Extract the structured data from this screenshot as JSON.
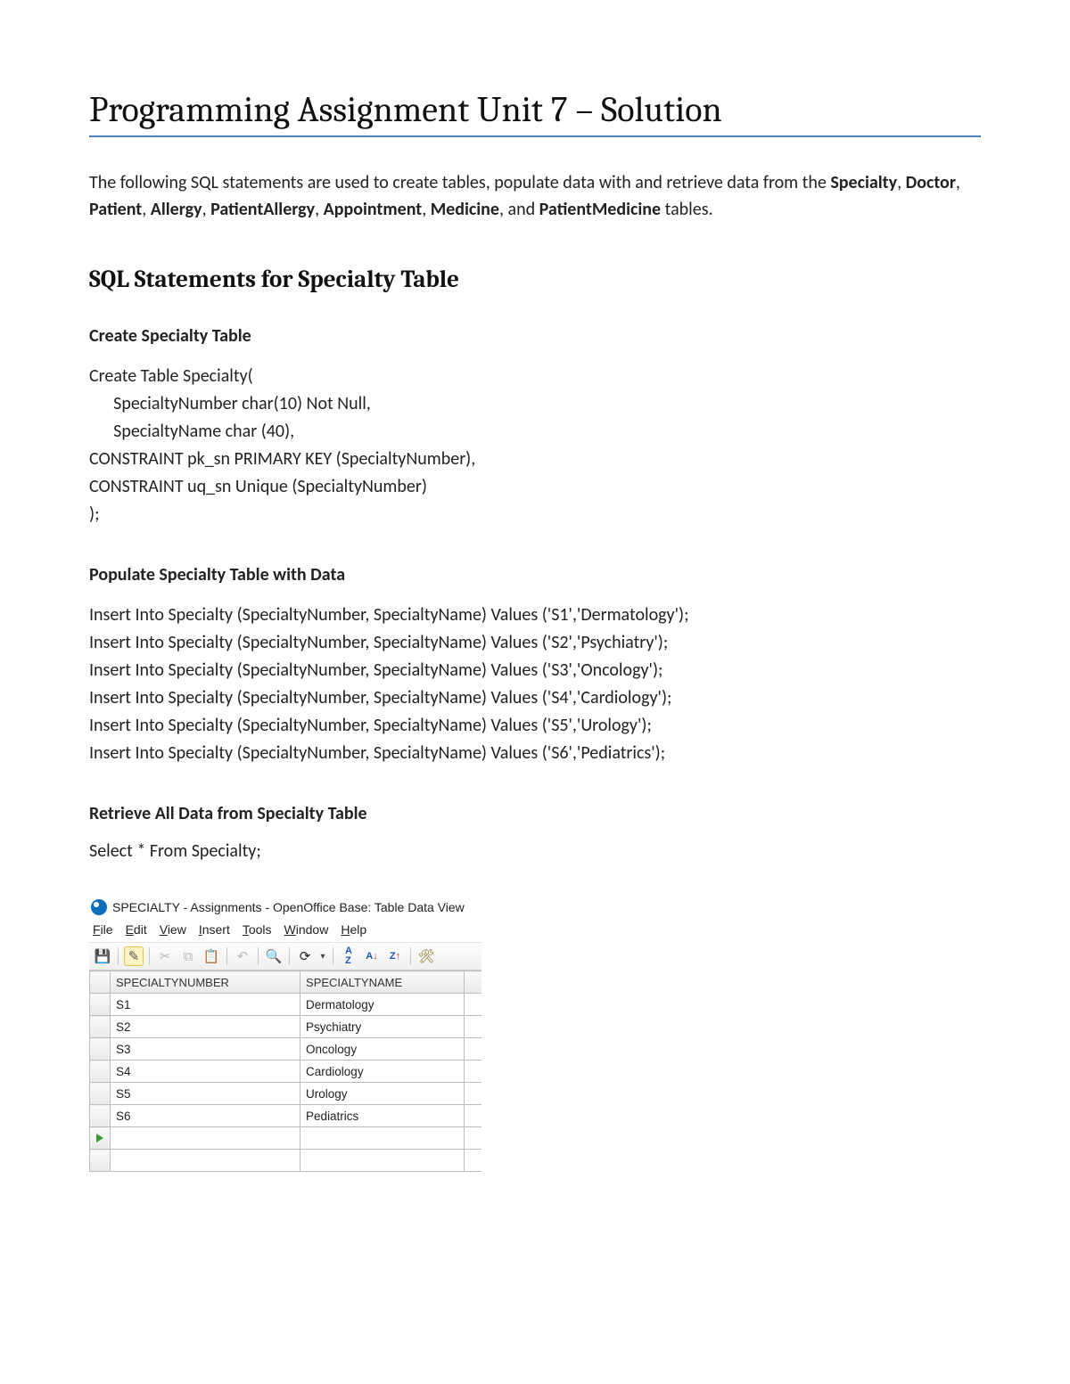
{
  "doc": {
    "title": "Programming Assignment Unit 7 – Solution",
    "intro_pre": "The following SQL statements are used to create tables, populate data with and retrieve data from the ",
    "intro_bold_tables": [
      "Specialty",
      "Doctor",
      "Patient",
      "Allergy",
      "PatientAllergy",
      "Appointment",
      "Medicine",
      "PatientMedicine"
    ],
    "intro_join_last": ", and ",
    "intro_post": " tables.",
    "section_heading": "SQL Statements for Specialty Table",
    "sub_create": "Create Specialty Table",
    "create_sql": "Create Table Specialty(\n      SpecialtyNumber char(10) Not Null,\n      SpecialtyName char (40),\nCONSTRAINT pk_sn PRIMARY KEY (SpecialtyNumber),\nCONSTRAINT uq_sn Unique (SpecialtyNumber)\n);",
    "sub_populate": "Populate Specialty Table with Data",
    "insert_sql": "Insert Into Specialty (SpecialtyNumber, SpecialtyName) Values ('S1','Dermatology');\nInsert Into Specialty (SpecialtyNumber, SpecialtyName) Values ('S2','Psychiatry');\nInsert Into Specialty (SpecialtyNumber, SpecialtyName) Values ('S3','Oncology');\nInsert Into Specialty (SpecialtyNumber, SpecialtyName) Values ('S4','Cardiology');\nInsert Into Specialty (SpecialtyNumber, SpecialtyName) Values ('S5','Urology');\nInsert Into Specialty (SpecialtyNumber, SpecialtyName) Values ('S6','Pediatrics');",
    "sub_retrieve": "Retrieve All Data from Specialty Table",
    "select_sql": "Select * From Specialty;"
  },
  "app": {
    "title": "SPECIALTY - Assignments - OpenOffice Base: Table Data View",
    "menu": {
      "file": "File",
      "edit": "Edit",
      "view": "View",
      "insert": "Insert",
      "tools": "Tools",
      "window": "Window",
      "help": "Help"
    },
    "sort_labels": {
      "az": "A\nZ",
      "azdown": "A\nZ",
      "zaup": "Z\nA"
    },
    "columns": [
      "SPECIALTYNUMBER",
      "SPECIALTYNAME"
    ],
    "rows": [
      {
        "num": "S1",
        "name": "Dermatology"
      },
      {
        "num": "S2",
        "name": "Psychiatry"
      },
      {
        "num": "S3",
        "name": "Oncology"
      },
      {
        "num": "S4",
        "name": "Cardiology"
      },
      {
        "num": "S5",
        "name": "Urology"
      },
      {
        "num": "S6",
        "name": "Pediatrics"
      }
    ]
  }
}
